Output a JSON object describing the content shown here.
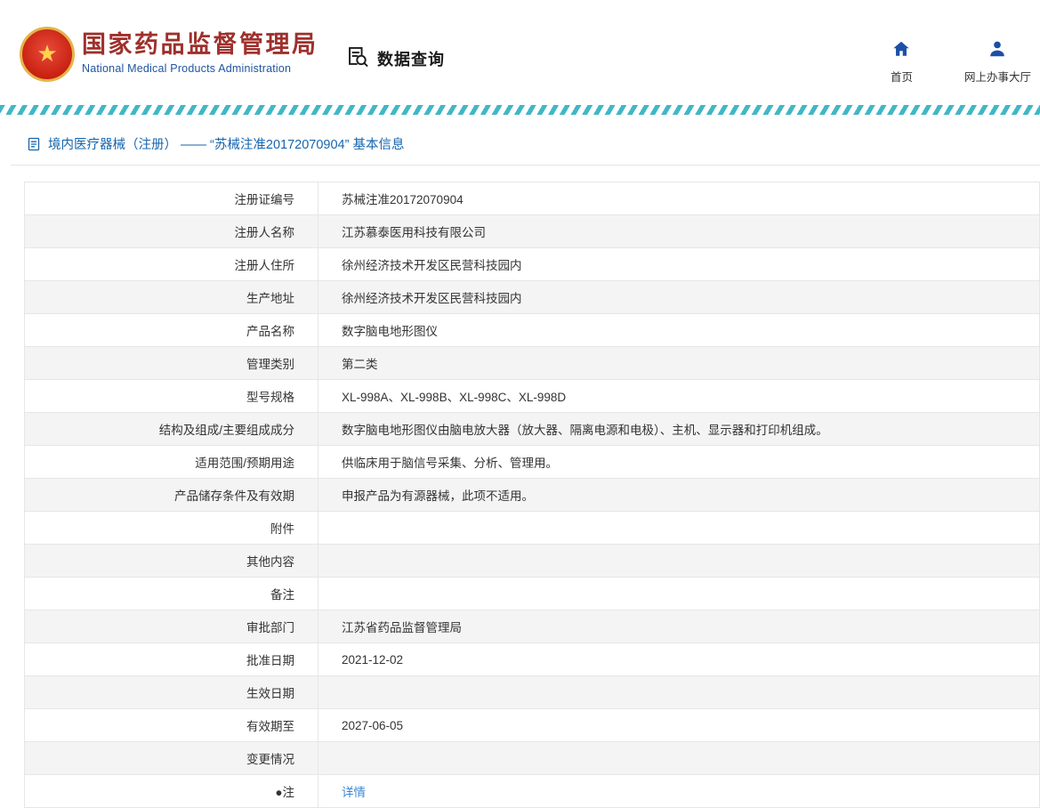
{
  "header": {
    "org_name_cn": "国家药品监督管理局",
    "org_name_en": "National Medical Products Administration",
    "query_label": "数据查询",
    "nav_home": "首页",
    "nav_hall": "网上办事大厅"
  },
  "breadcrumb": {
    "text": "境内医疗器械（注册） —— “苏械注准20172070904” 基本信息"
  },
  "colors": {
    "brand_red": "#9e302c",
    "brand_blue": "#1f55a0",
    "link_blue": "#3a87d4",
    "stripe_teal": "#41b7c6",
    "row_alt_gray": "#f4f4f4"
  },
  "table": {
    "rows": [
      {
        "label": "注册证编号",
        "value": "苏械注准20172070904"
      },
      {
        "label": "注册人名称",
        "value": "江苏慕泰医用科技有限公司"
      },
      {
        "label": "注册人住所",
        "value": "徐州经济技术开发区民营科技园内"
      },
      {
        "label": "生产地址",
        "value": "徐州经济技术开发区民营科技园内"
      },
      {
        "label": "产品名称",
        "value": "数字脑电地形图仪"
      },
      {
        "label": "管理类别",
        "value": "第二类"
      },
      {
        "label": "型号规格",
        "value": "XL-998A、XL-998B、XL-998C、XL-998D"
      },
      {
        "label": "结构及组成/主要组成成分",
        "value": "数字脑电地形图仪由脑电放大器（放大器、隔离电源和电极）、主机、显示器和打印机组成。"
      },
      {
        "label": "适用范围/预期用途",
        "value": "供临床用于脑信号采集、分析、管理用。"
      },
      {
        "label": "产品储存条件及有效期",
        "value": "申报产品为有源器械，此项不适用。"
      },
      {
        "label": "附件",
        "value": ""
      },
      {
        "label": "其他内容",
        "value": ""
      },
      {
        "label": "备注",
        "value": ""
      },
      {
        "label": "审批部门",
        "value": "江苏省药品监督管理局"
      },
      {
        "label": "批准日期",
        "value": "2021-12-02"
      },
      {
        "label": "生效日期",
        "value": ""
      },
      {
        "label": "有效期至",
        "value": "2027-06-05"
      },
      {
        "label": "变更情况",
        "value": ""
      },
      {
        "label": "●注",
        "value": "详情",
        "link": true
      }
    ]
  }
}
